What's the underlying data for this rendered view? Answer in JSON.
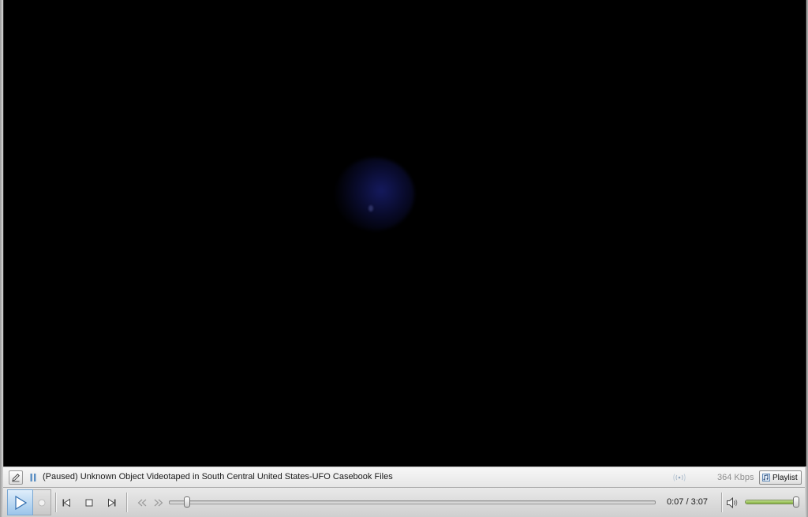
{
  "info_bar": {
    "status_title": "(Paused) Unknown Object Videotaped in South Central United States-UFO Casebook Files",
    "bitrate": "364 Kbps",
    "playlist_label": "Playlist",
    "icons": {
      "edit": "edit-pencil-icon",
      "pause": "pause-icon",
      "signal": "broadcast-signal-icon",
      "playlist": "playlist-icon"
    }
  },
  "controls": {
    "time_display": "0:07 / 3:07",
    "elapsed": "0:07",
    "duration": "3:07",
    "seek_fraction": 0.038,
    "volume_fraction": 0.98,
    "icons": {
      "play": "play-icon",
      "record": "record-icon",
      "previous": "skip-previous-icon",
      "stop": "stop-icon",
      "next": "skip-next-icon",
      "rewind": "rewind-icon",
      "fast_forward": "fast-forward-icon",
      "volume": "speaker-icon"
    }
  },
  "colors": {
    "play_button": "#9cc5ea",
    "volume_fill": "#7fae3a",
    "video_background": "#000000"
  }
}
